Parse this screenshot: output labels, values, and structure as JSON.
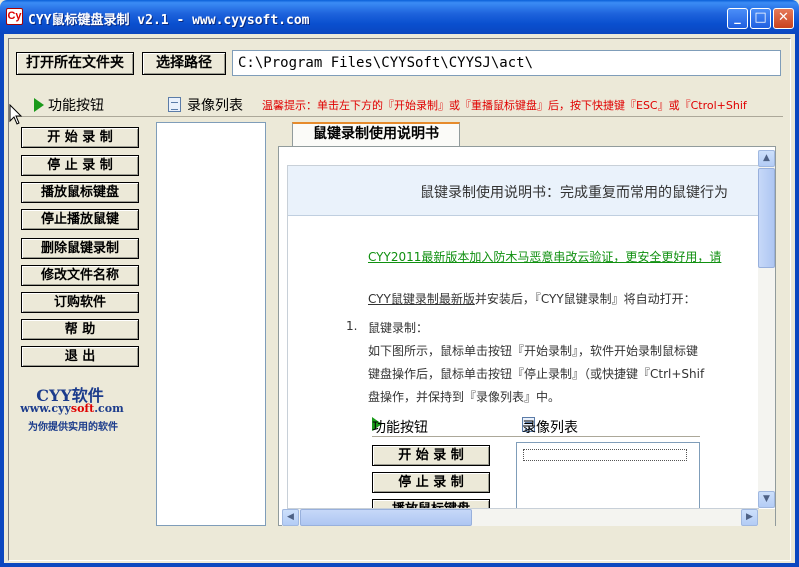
{
  "window": {
    "title": "CYY鼠标键盘录制 v2.1 - www.cyysoft.com",
    "icon_label": "Cy",
    "minimize": "_",
    "maximize": "□",
    "close": "✕"
  },
  "toolbar": {
    "open_folder_label": "打开所在文件夹",
    "choose_path_label": "选择路径",
    "path_value": "C:\\Program Files\\CYYSoft\\CYYSJ\\act\\"
  },
  "tabs": {
    "functions_label": "功能按钮",
    "recordings_label": "录像列表",
    "hint": "温馨提示：单击左下方的『开始录制』或『重播鼠标键盘』后，按下快捷键『ESC』或『Ctrol+Shif"
  },
  "sidebar": {
    "buttons": [
      {
        "label": "开 始 录 制"
      },
      {
        "label": "停 止 录 制"
      },
      {
        "label": "播放鼠标键盘"
      },
      {
        "label": "停止播放鼠键"
      },
      {
        "label": "删除鼠键录制"
      },
      {
        "label": "修改文件名称"
      },
      {
        "label": "订购软件"
      },
      {
        "label": "帮    助"
      },
      {
        "label": "退    出"
      }
    ],
    "brand": {
      "title": "CYY软件",
      "url_prefix": "www.cyy",
      "url_highlight": "soft",
      "url_suffix": ".com",
      "slogan": "为你提供实用的软件"
    }
  },
  "document": {
    "tab_label": "鼠键录制使用说明书",
    "header": "鼠键录制使用说明书：完成重复而常用的鼠键行为",
    "green_link": "CYY2011最新版本加入防木马恶意串改云验证，更安全更好用，请",
    "intro_link": "CYY鼠键录制最新版",
    "intro_rest": "并安装后，『CYY鼠键录制』将自动打开：",
    "item_number": "1.",
    "item_title": "鼠键录制：",
    "para1": "如下图所示，鼠标单击按钮『开始录制』，软件开始录制鼠标键",
    "para2": "键盘操作后，鼠标单击按钮『停止录制』（或快捷键『Ctrl+Shif",
    "para3": "盘操作，并保持到『录像列表』中。",
    "embed": {
      "functions_label": "功能按钮",
      "recordings_label": "录像列表",
      "buttons": [
        {
          "label": "开 始 录 制"
        },
        {
          "label": "停 止 录 制"
        },
        {
          "label": "播放鼠标键盘"
        }
      ]
    }
  },
  "scroll": {
    "up": "▲",
    "down": "▼",
    "left": "◀",
    "right": "▶"
  }
}
